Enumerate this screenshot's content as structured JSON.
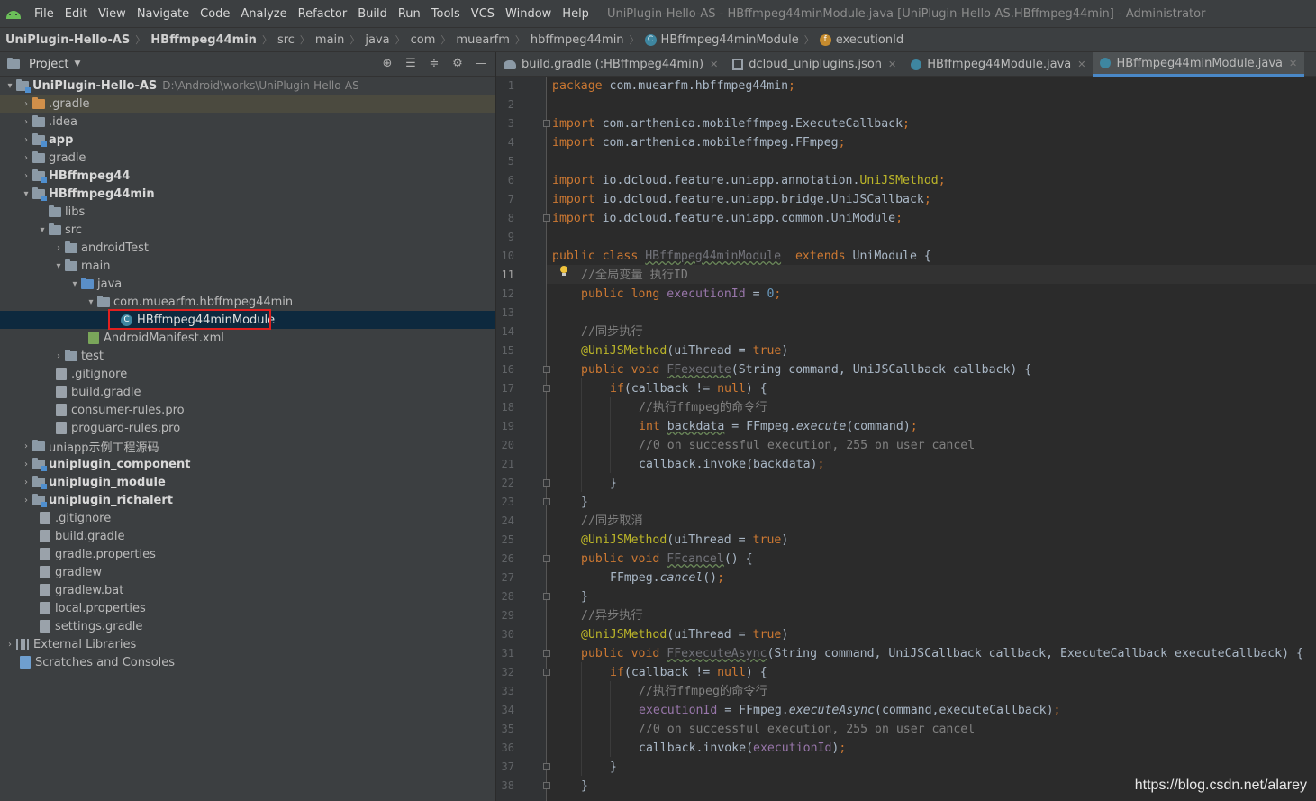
{
  "menubar": {
    "items": [
      "File",
      "Edit",
      "View",
      "Navigate",
      "Code",
      "Analyze",
      "Refactor",
      "Build",
      "Run",
      "Tools",
      "VCS",
      "Window",
      "Help"
    ],
    "window_title": "UniPlugin-Hello-AS - HBffmpeg44minModule.java [UniPlugin-Hello-AS.HBffmpeg44min] - Administrator"
  },
  "breadcrumb": [
    "UniPlugin-Hello-AS",
    "HBffmpeg44min",
    "src",
    "main",
    "java",
    "com",
    "muearfm",
    "hbffmpeg44min",
    "HBffmpeg44minModule",
    "executionId"
  ],
  "project_panel": {
    "title": "Project",
    "tree": [
      {
        "label": "UniPlugin-Hello-AS",
        "path": "D:\\Android\\works\\UniPlugin-Hello-AS"
      },
      {
        "label": ".gradle"
      },
      {
        "label": ".idea"
      },
      {
        "label": "app"
      },
      {
        "label": "gradle"
      },
      {
        "label": "HBffmpeg44"
      },
      {
        "label": "HBffmpeg44min"
      },
      {
        "label": "libs"
      },
      {
        "label": "src"
      },
      {
        "label": "androidTest"
      },
      {
        "label": "main"
      },
      {
        "label": "java"
      },
      {
        "label": "com.muearfm.hbffmpeg44min"
      },
      {
        "label": "HBffmpeg44minModule"
      },
      {
        "label": "AndroidManifest.xml"
      },
      {
        "label": "test"
      },
      {
        "label": ".gitignore"
      },
      {
        "label": "build.gradle"
      },
      {
        "label": "consumer-rules.pro"
      },
      {
        "label": "proguard-rules.pro"
      },
      {
        "label": "uniapp示例工程源码"
      },
      {
        "label": "uniplugin_component"
      },
      {
        "label": "uniplugin_module"
      },
      {
        "label": "uniplugin_richalert"
      },
      {
        "label": ".gitignore"
      },
      {
        "label": "build.gradle"
      },
      {
        "label": "gradle.properties"
      },
      {
        "label": "gradlew"
      },
      {
        "label": "gradlew.bat"
      },
      {
        "label": "local.properties"
      },
      {
        "label": "settings.gradle"
      },
      {
        "label": "External Libraries"
      },
      {
        "label": "Scratches and Consoles"
      }
    ]
  },
  "tabs": [
    {
      "label": "build.gradle (:HBffmpeg44min)"
    },
    {
      "label": "dcloud_uniplugins.json"
    },
    {
      "label": "HBffmpeg44Module.java"
    },
    {
      "label": "HBffmpeg44minModule.java",
      "active": true
    }
  ],
  "editor": {
    "current_line": 11,
    "line_numbers": [
      "1",
      "2",
      "3",
      "4",
      "5",
      "6",
      "7",
      "8",
      "9",
      "10",
      "11",
      "12",
      "13",
      "14",
      "15",
      "16",
      "17",
      "18",
      "19",
      "20",
      "21",
      "22",
      "23",
      "24",
      "25",
      "26",
      "27",
      "28",
      "29",
      "30",
      "31",
      "32",
      "33",
      "34",
      "35",
      "36",
      "37",
      "38"
    ],
    "code": {
      "l1_kw": "package",
      "l1_rest": " com.muearfm.hbffmpeg44min",
      "import_kw": "import",
      "l3": " com.arthenica.mobileffmpeg.ExecuteCallback",
      "l4": " com.arthenica.mobileffmpeg.FFmpeg",
      "l6_a": " io.dcloud.feature.uniapp.annotation.",
      "l6_b": "UniJSMethod",
      "l7": " io.dcloud.feature.uniapp.bridge.UniJSCallback",
      "l8": " io.dcloud.feature.uniapp.common.UniModule",
      "l10_kw": "public class",
      "l10_name": "HBffmpeg44minModule",
      "l10_ext": "extends",
      "l10_rest": " UniModule {",
      "l11": "//全局变量 执行ID",
      "l12_kw": "public long",
      "l12_fd": "executionId",
      "l12_num": "0",
      "l14": "//同步执行",
      "ann": "@UniJSMethod",
      "ann_args": "(uiThread = ",
      "true_kw": "true",
      "l16_kw": "public void",
      "l16_name": "FFexecute",
      "l16_rest": "(String command, UniJSCallback callback) {",
      "if_kw": "if",
      "if_rest": "(callback != ",
      "null_kw": "null",
      "if_end": ") {",
      "l18": "//执行ffmpeg的命令行",
      "l19_kw": "int",
      "l19_var": "backdata",
      "l19_mid": " = FFmpeg.",
      "l19_fn": "execute",
      "l19_end": "(command)",
      "l20": "//0 on successful execution, 255 on user cancel",
      "l21": "callback.invoke(backdata)",
      "brace": "}",
      "l24": "//同步取消",
      "l26_kw": "public void",
      "l26_name": "FFcancel",
      "l26_rest": "() {",
      "l27_a": "FFmpeg.",
      "l27_fn": "cancel",
      "l27_end": "()",
      "l29": "//异步执行",
      "l31_kw": "public void",
      "l31_name": "FFexecuteAsync",
      "l31_rest": "(String command, UniJSCallback callback, ExecuteCallback executeCallback) {",
      "l33": "//执行ffmpeg的命令行",
      "l34_fd": "executionId",
      "l34_mid": " = FFmpeg.",
      "l34_fn": "executeAsync",
      "l34_end": "(command,executeCallback)",
      "l35": "//0 on successful execution, 255 on user cancel",
      "l36_a": "callback.invoke(",
      "l36_fd": "executionId",
      "l36_end": ")",
      "semi": ";",
      "comma": ", ",
      "eq": " = "
    }
  },
  "watermark": "https://blog.csdn.net/alarey",
  "colors": {
    "accent": "#4a88c7",
    "selection": "#0d293e",
    "highlight_box": "#e0201f",
    "keyword": "#cc7832"
  }
}
